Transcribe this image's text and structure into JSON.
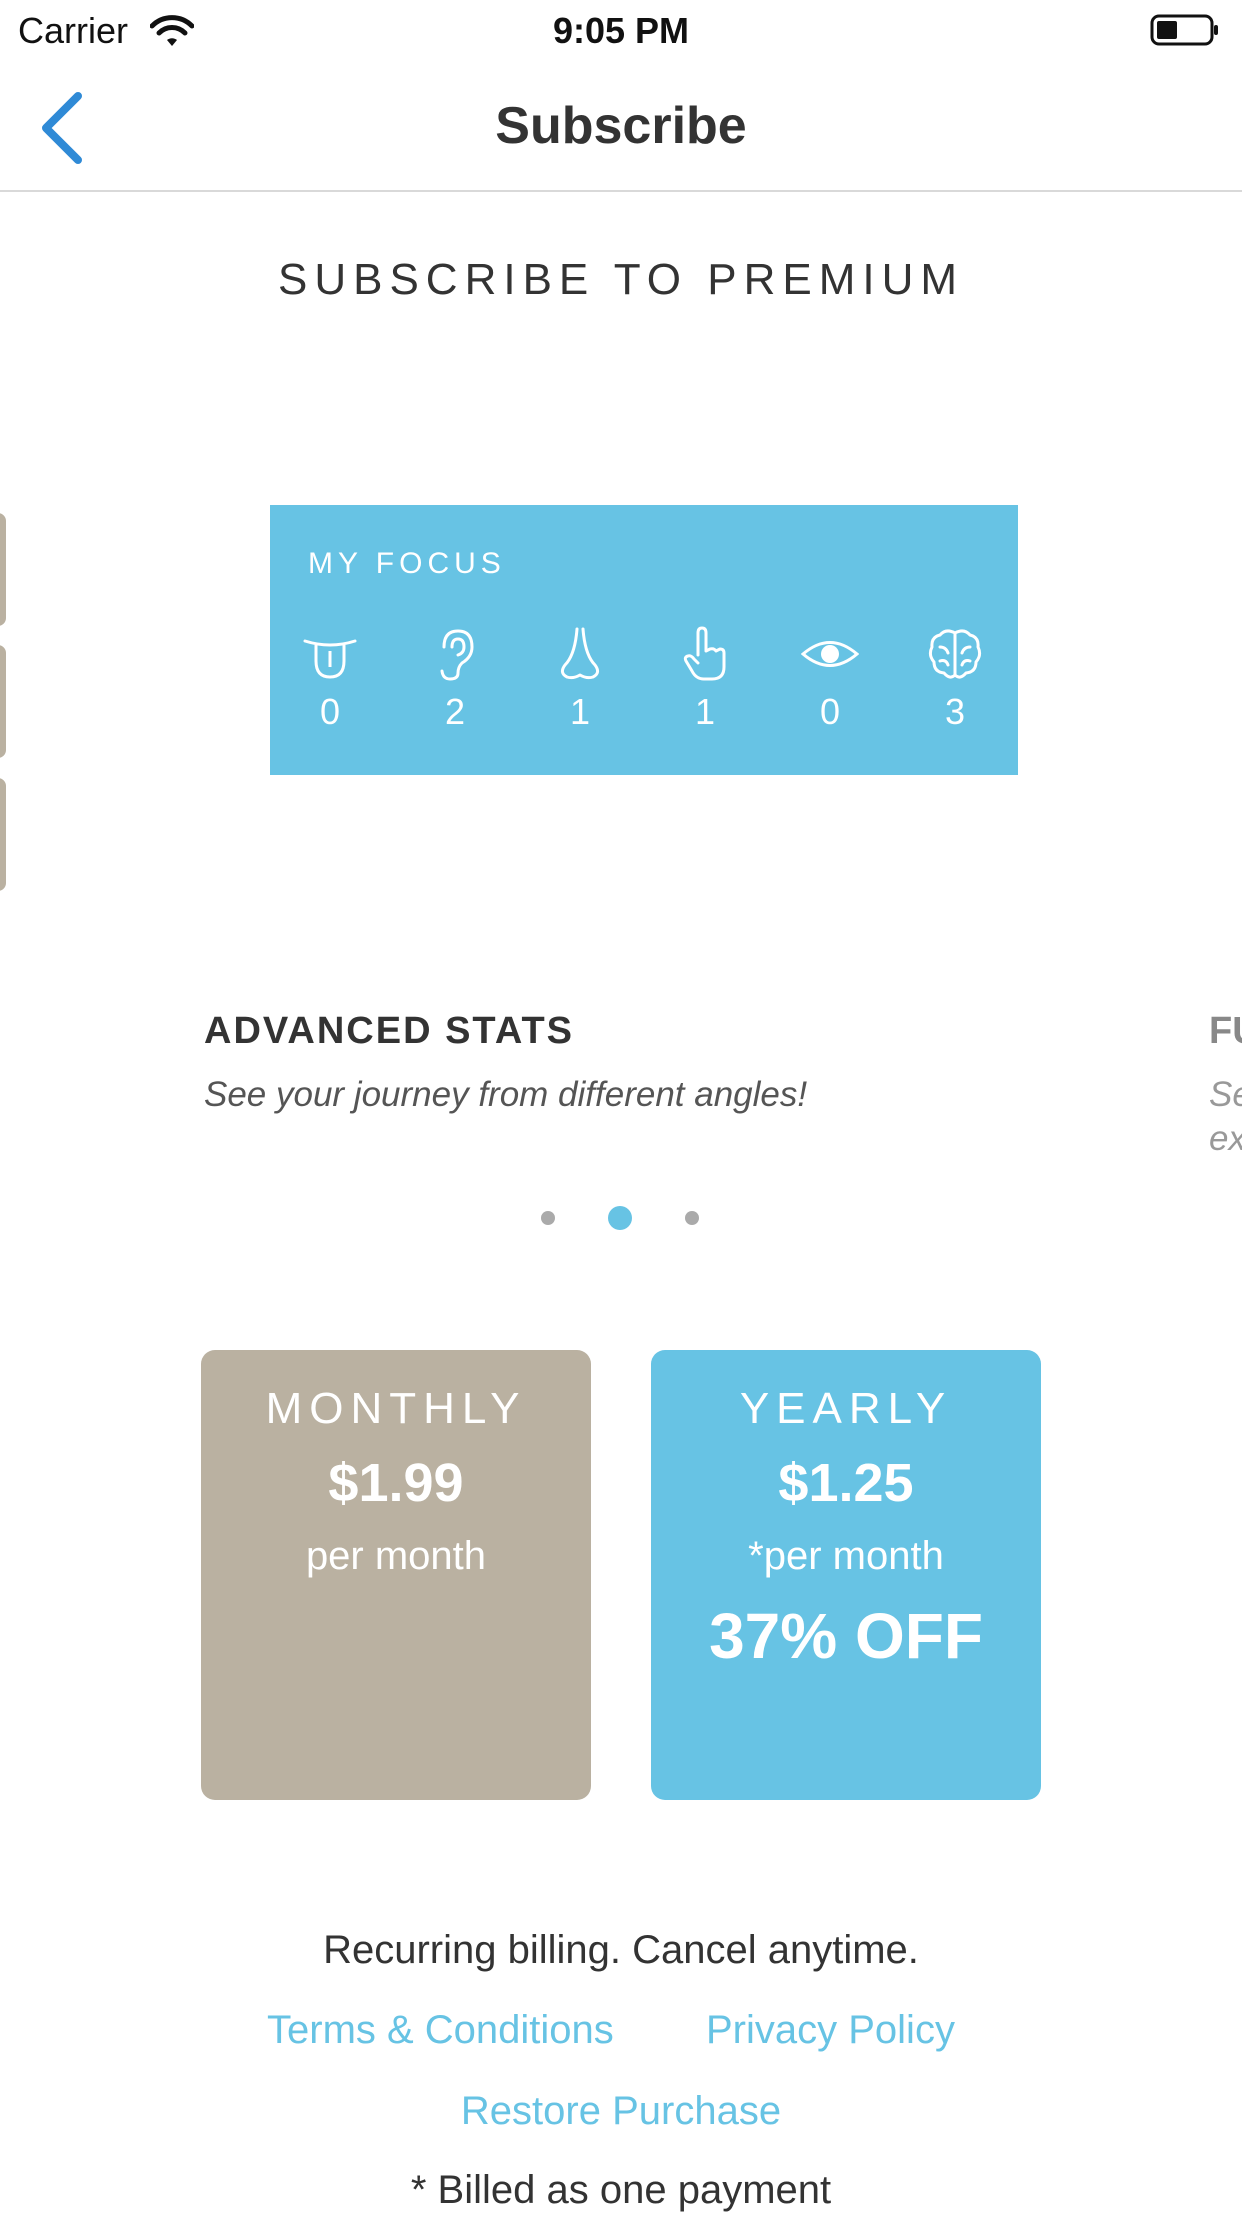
{
  "status_bar": {
    "carrier": "Carrier",
    "time": "9:05 PM"
  },
  "nav": {
    "title": "Subscribe",
    "back_icon": "chevron-left-icon"
  },
  "heading": "SUBSCRIBE TO PREMIUM",
  "focus_card": {
    "title": "MY FOCUS",
    "senses": [
      {
        "icon": "tongue-icon",
        "count": "0"
      },
      {
        "icon": "ear-icon",
        "count": "2"
      },
      {
        "icon": "nose-icon",
        "count": "1"
      },
      {
        "icon": "hand-icon",
        "count": "1"
      },
      {
        "icon": "eye-icon",
        "count": "0"
      },
      {
        "icon": "brain-icon",
        "count": "3"
      }
    ]
  },
  "carousel": {
    "title": "ADVANCED STATS",
    "description": "See your journey from different angles!",
    "next_title": "FU",
    "next_description": "Se ex",
    "page_count": 3,
    "active_page": 2
  },
  "plans": {
    "monthly": {
      "name": "MONTHLY",
      "price": "$1.99",
      "period": "per month"
    },
    "yearly": {
      "name": "YEARLY",
      "price": "$1.25",
      "period": "*per month",
      "discount": "37% OFF"
    }
  },
  "footer": {
    "billing_note": "Recurring billing. Cancel anytime.",
    "terms": "Terms & Conditions",
    "privacy": "Privacy Policy",
    "restore": "Restore Purchase",
    "footnote": "* Billed as one payment"
  },
  "colors": {
    "accent": "#67c3e4",
    "monthly": "#bab1a1",
    "back": "#2f8ad6"
  }
}
